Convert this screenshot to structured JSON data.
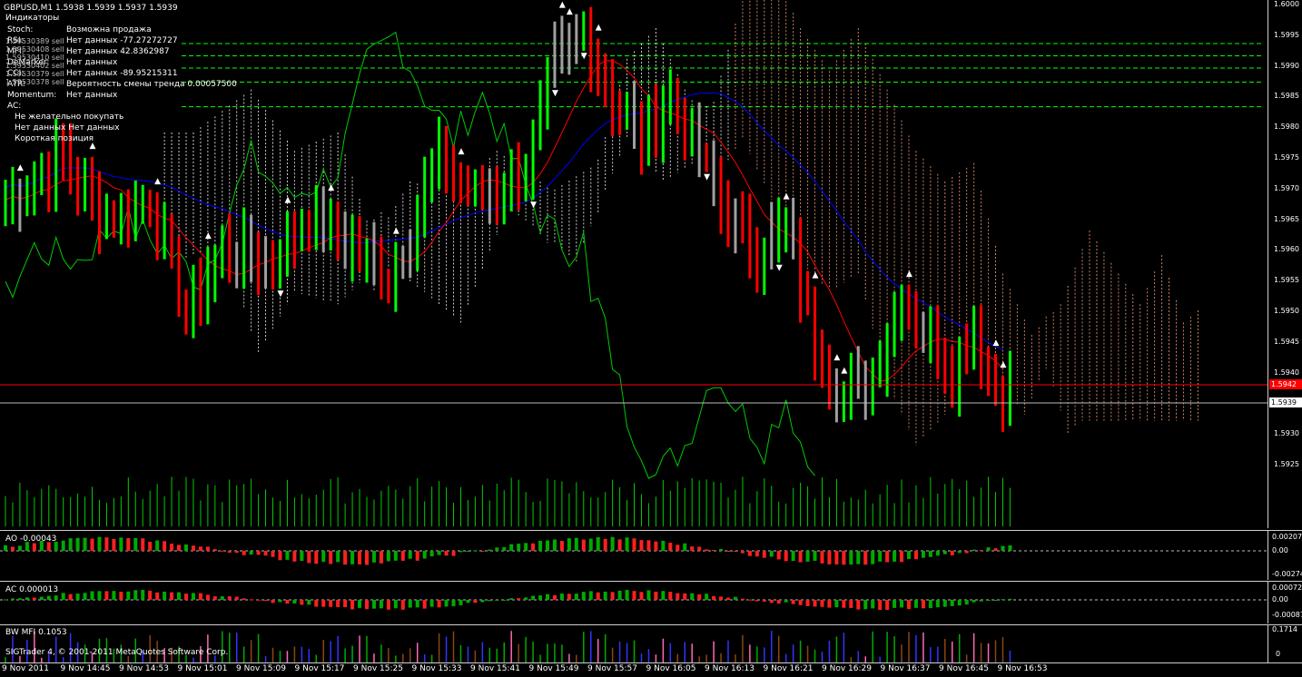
{
  "header": {
    "symbol": "GBPUSD,M1  1.5938 1.5939 1.5937 1.5939",
    "indicators_title": "Индикаторы"
  },
  "signals": [
    {
      "name": "Stoch:",
      "value": "Возможна продажа"
    },
    {
      "name": "RSI:",
      "value": "Нет данных -77.27272727"
    },
    {
      "name": "MFI:",
      "value": "Нет данных 42.8362987"
    },
    {
      "name": "DeMarker:",
      "value": "Нет данных"
    },
    {
      "name": "CCI:",
      "value": "Нет данных -89.95215311"
    },
    {
      "name": "ATR:",
      "value": "Вероятность смены тренда 0.00057500"
    },
    {
      "name": "Momentum:",
      "value": "Нет данных"
    },
    {
      "name": "AC:",
      "value": ""
    }
  ],
  "summary": [
    "Не желательно покупать",
    "Нет данных Нет данных",
    "Короткая позиция"
  ],
  "order_lines": [
    "1.59530389 sell",
    "1.59530408 sell",
    "1.59530410 sell",
    "1.59530402 sell",
    "1.59530379 sell",
    "1.59530378 sell"
  ],
  "price_scale": [
    "1.6000",
    "1.5995",
    "1.5990",
    "1.5985",
    "1.5980",
    "1.5975",
    "1.5970",
    "1.5965",
    "1.5960",
    "1.5955",
    "1.5950",
    "1.5945",
    "1.5940",
    "1.5935",
    "1.5930",
    "1.5925"
  ],
  "current_price": "1.5939",
  "line_price": "1.5942",
  "ao": {
    "label": "AO -0.00043",
    "scale": [
      "0.00207",
      "0.00",
      "-0.00274"
    ]
  },
  "ac": {
    "label": "AC 0.000013",
    "scale": [
      "0.00072",
      "0.00",
      "-0.00087"
    ]
  },
  "mfi": {
    "label": "BW MFI 0.1053",
    "scale": [
      "0.1714",
      "0"
    ]
  },
  "copyright": "SIGTrader 4, © 2001-2011 MetaQuotes Software Corp.",
  "time_axis": [
    "9 Nov 2011",
    "9 Nov 14:45",
    "9 Nov 14:53",
    "9 Nov 15:01",
    "9 Nov 15:09",
    "9 Nov 15:17",
    "9 Nov 15:25",
    "9 Nov 15:33",
    "9 Nov 15:41",
    "9 Nov 15:49",
    "9 Nov 15:57",
    "9 Nov 16:05",
    "9 Nov 16:13",
    "9 Nov 16:21",
    "9 Nov 16:29",
    "9 Nov 16:37",
    "9 Nov 16:45",
    "9 Nov 16:53"
  ],
  "colors": {
    "up": "#00ff00",
    "down": "#ff0000",
    "neutral": "#a0a0a0",
    "kijun": "#0000ff",
    "tenkan": "#ff0000",
    "chikou": "#00cc00",
    "cloud": "#ffffff",
    "cloud2": "#ffa07a",
    "orders": "#00ff00"
  }
}
